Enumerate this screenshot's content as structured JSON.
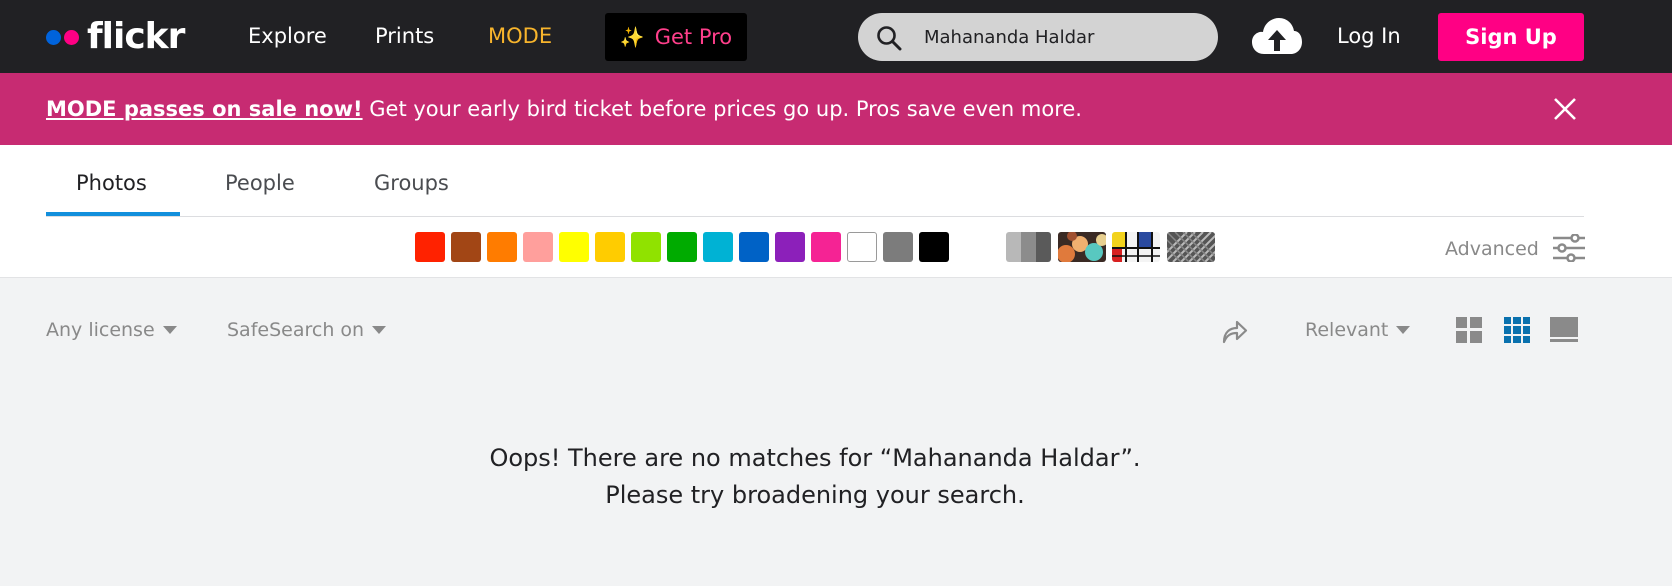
{
  "header": {
    "logo_text": "flickr",
    "nav": {
      "explore": "Explore",
      "prints": "Prints",
      "mode": "MODE"
    },
    "get_pro": "Get Pro",
    "search_value": "Mahananda Haldar",
    "log_in": "Log In",
    "sign_up": "Sign Up",
    "colors": {
      "bg": "#212124",
      "brand_blue": "#0063dc",
      "brand_pink": "#ff0084",
      "mode": "#f8b52c"
    }
  },
  "banner": {
    "link_text": "MODE passes on sale now!",
    "message": "Get your early bird ticket before prices go up. Pros save even more.",
    "bg_color": "#c72b72"
  },
  "tabs": [
    {
      "label": "Photos",
      "active": true
    },
    {
      "label": "People",
      "active": false
    },
    {
      "label": "Groups",
      "active": false
    }
  ],
  "color_filters": [
    {
      "name": "red",
      "color": "#ff2200"
    },
    {
      "name": "brown",
      "color": "#a24615"
    },
    {
      "name": "orange",
      "color": "#ff7c00"
    },
    {
      "name": "pink",
      "color": "#ff9f9c"
    },
    {
      "name": "yellow",
      "color": "#ffff00"
    },
    {
      "name": "gold",
      "color": "#ffcc00"
    },
    {
      "name": "lime",
      "color": "#90e200"
    },
    {
      "name": "green",
      "color": "#00ab00"
    },
    {
      "name": "teal",
      "color": "#00b2d4"
    },
    {
      "name": "blue",
      "color": "#0062c6"
    },
    {
      "name": "purple",
      "color": "#8c20ba"
    },
    {
      "name": "magenta",
      "color": "#f52394"
    },
    {
      "name": "white",
      "color": "#ffffff"
    },
    {
      "name": "gray",
      "color": "#7c7c7c"
    },
    {
      "name": "black",
      "color": "#000000"
    }
  ],
  "style_filters": [
    "black-and-white",
    "shallow-depth-of-field",
    "minimalism",
    "patterns"
  ],
  "advanced_label": "Advanced",
  "toolbar": {
    "license": "Any license",
    "safesearch": "SafeSearch on",
    "sort": "Relevant",
    "views": [
      "grid-large-view",
      "justified-view",
      "single-view"
    ],
    "active_view": "justified-view",
    "active_color": "#0a71ae"
  },
  "empty_state": {
    "line1": "Oops! There are no matches for “Mahananda Haldar”.",
    "line2": "Please try broadening your search."
  }
}
